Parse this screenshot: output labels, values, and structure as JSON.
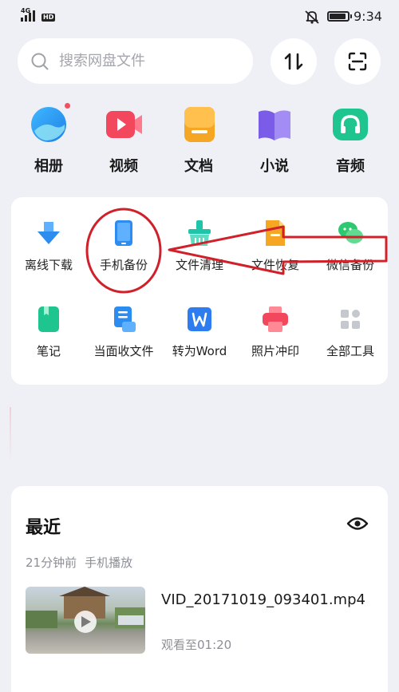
{
  "status": {
    "network": "4G",
    "hd": "HD",
    "time": "9:34",
    "battery_level": 0.9
  },
  "search": {
    "placeholder": "搜索网盘文件"
  },
  "categories": [
    {
      "label": "相册",
      "icon": "album-icon",
      "color": "#2d9bf0",
      "badge": true
    },
    {
      "label": "视频",
      "icon": "video-icon",
      "color": "#f2475c"
    },
    {
      "label": "文档",
      "icon": "document-icon",
      "color": "#f5a623"
    },
    {
      "label": "小说",
      "icon": "novel-icon",
      "color": "#8b6cf0"
    },
    {
      "label": "音频",
      "icon": "audio-icon",
      "color": "#1fc58e"
    }
  ],
  "tools": [
    {
      "label": "离线下载",
      "icon": "offline-download-icon",
      "color": "#2d8cf0"
    },
    {
      "label": "手机备份",
      "icon": "phone-backup-icon",
      "color": "#2d8cf0"
    },
    {
      "label": "文件清理",
      "icon": "file-cleanup-icon",
      "color": "#1fc5a8"
    },
    {
      "label": "文件恢复",
      "icon": "file-restore-icon",
      "color": "#f5a623"
    },
    {
      "label": "微信备份",
      "icon": "wechat-backup-icon",
      "color": "#2dc86f"
    },
    {
      "label": "笔记",
      "icon": "notes-icon",
      "color": "#1fc58e"
    },
    {
      "label": "当面收文件",
      "icon": "receive-files-icon",
      "color": "#2d8cf0"
    },
    {
      "label": "转为Word",
      "icon": "convert-word-icon",
      "color": "#2d7cf0"
    },
    {
      "label": "照片冲印",
      "icon": "photo-print-icon",
      "color": "#f2475c"
    },
    {
      "label": "全部工具",
      "icon": "all-tools-icon",
      "color": "#c5c8ce"
    }
  ],
  "recent": {
    "title": "最近",
    "meta_time": "21分钟前",
    "meta_source": "手机播放",
    "file_name": "VID_20171019_093401.mp4",
    "file_sub": "观看至01:20"
  },
  "colors": {
    "accent": "#2d8cf0",
    "annotation": "#d0202a",
    "background": "#eef0f6"
  }
}
